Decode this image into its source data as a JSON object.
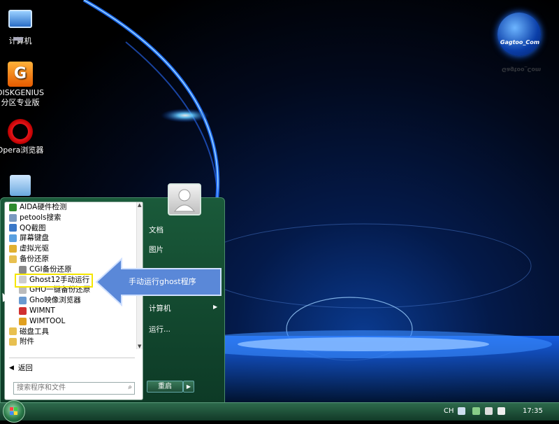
{
  "desktop": {
    "icons": [
      {
        "label": "计算机",
        "icon": "computer-icon"
      },
      {
        "label": "DISKGENIUS\n分区专业版",
        "icon": "diskgenius-icon"
      },
      {
        "label": "Opera浏览器",
        "icon": "opera-icon"
      }
    ],
    "logo_text": "Gagtoo_Com"
  },
  "start_menu": {
    "programs": [
      {
        "label": "AIDA硬件检测",
        "icon": "aida64-icon",
        "color": "#2e8b2e"
      },
      {
        "label": "petools搜索",
        "icon": "petools-icon",
        "color": "#7a9ac0"
      },
      {
        "label": "QQ截图",
        "icon": "qq-screenshot-icon",
        "color": "#3a78c8"
      },
      {
        "label": "屏幕键盘",
        "icon": "keyboard-icon",
        "color": "#5aa0e0"
      },
      {
        "label": "虚拟光驱",
        "icon": "virtual-drive-icon",
        "color": "#e0b030"
      },
      {
        "label": "备份还原",
        "icon": "folder-icon",
        "color": "#e8c050"
      },
      {
        "label": "CGI备份还原",
        "icon": "cgi-icon",
        "color": "#888"
      },
      {
        "label": "Ghost12手动运行",
        "icon": "ghost-icon",
        "color": "#ccc"
      },
      {
        "label": "GHO一键备份还原",
        "icon": "gho-icon",
        "color": "#bbb"
      },
      {
        "label": "Gho映像浏览器",
        "icon": "gho-viewer-icon",
        "color": "#6a9ad0"
      },
      {
        "label": "WIMNT",
        "icon": "wimnt-icon",
        "color": "#d03030"
      },
      {
        "label": "WIMTOOL",
        "icon": "wimtool-icon",
        "color": "#e0a020"
      },
      {
        "label": "磁盘工具",
        "icon": "folder-icon",
        "color": "#e8c050"
      },
      {
        "label": "附件",
        "icon": "folder-icon",
        "color": "#e8c050"
      }
    ],
    "back_label": "返回",
    "search_placeholder": "搜索程序和文件",
    "right_items": [
      {
        "label": "文档",
        "has_arrow": false
      },
      {
        "label": "图片",
        "has_arrow": false
      },
      {
        "label": "计算机",
        "has_arrow": true
      },
      {
        "label": "运行...",
        "has_arrow": false
      }
    ],
    "restart_label": "重启"
  },
  "callout": {
    "text": "手动运行ghost程序"
  },
  "taskbar": {
    "language": "CH",
    "clock": "17:35"
  }
}
